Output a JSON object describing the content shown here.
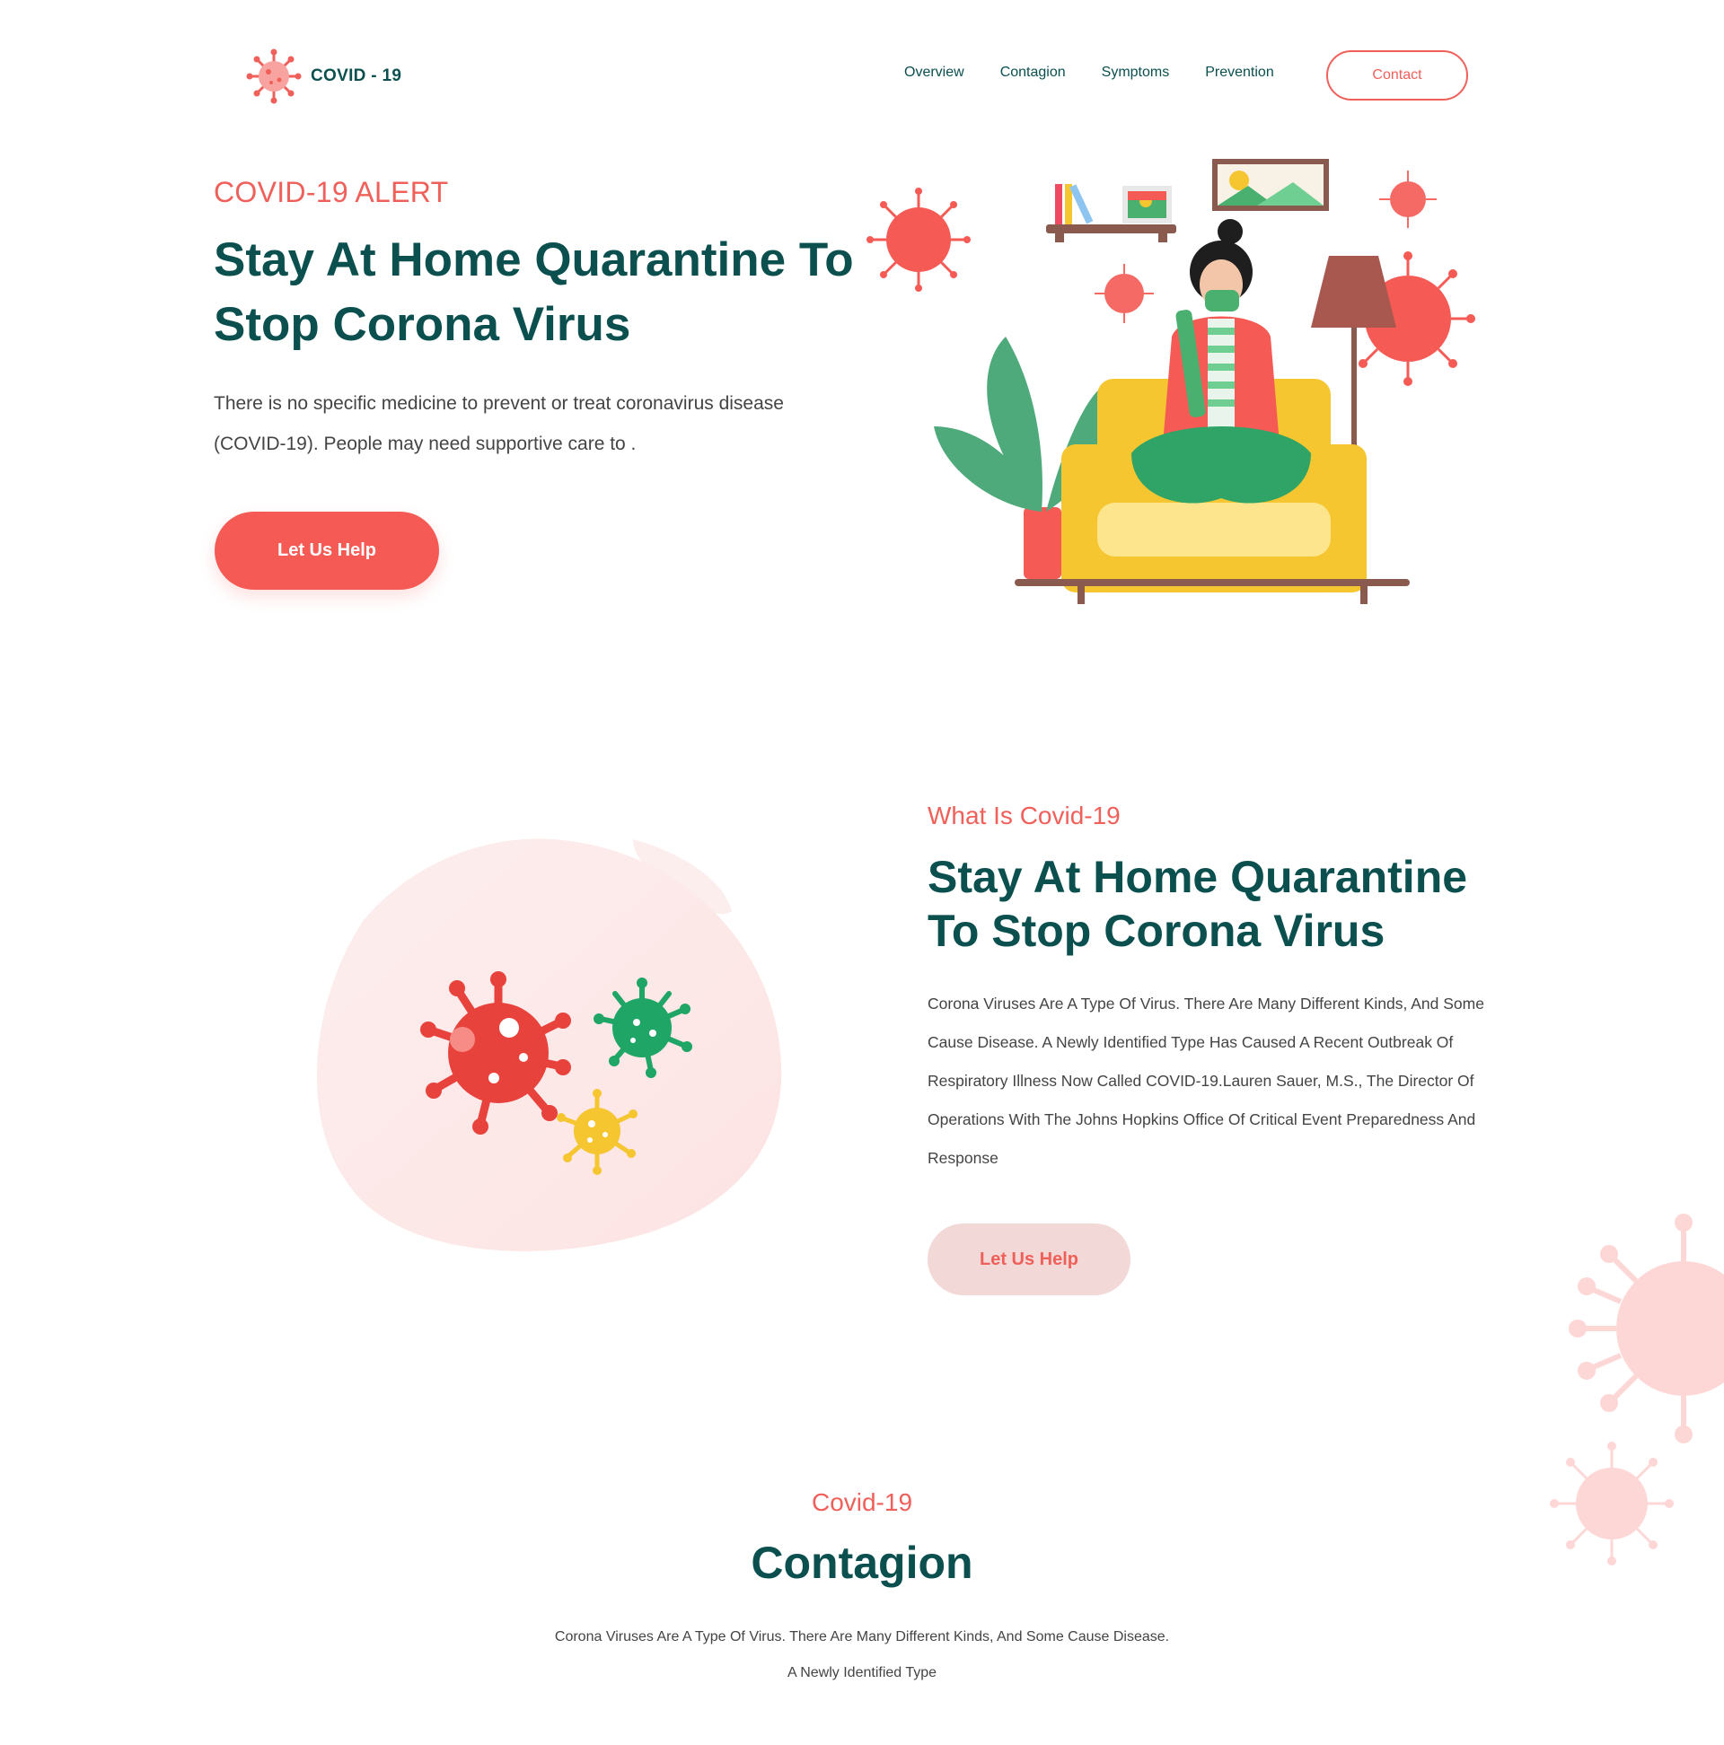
{
  "colors": {
    "brand_red": "#f0605a",
    "heading_teal": "#0b4f4f",
    "body_text": "#444444",
    "soft_pink": "#f2d8d6"
  },
  "nav": {
    "logo_text": "COVID - 19",
    "logo_icon": "virus-icon",
    "items": [
      {
        "label": "Overview"
      },
      {
        "label": "Contagion"
      },
      {
        "label": "Symptoms"
      },
      {
        "label": "Prevention"
      }
    ],
    "contact_label": "Contact"
  },
  "hero": {
    "eyebrow": "COVID-19 ALERT",
    "title": "Stay At Home Quarantine To Stop Corona Virus",
    "text": "There is no specific medicine to prevent or treat coronavirus disease (COVID-19). People may need supportive care to .",
    "button_label": "Let Us Help",
    "illustration": "woman-on-sofa-illustration"
  },
  "about": {
    "eyebrow": "What Is Covid-19",
    "title": "Stay At Home Quarantine To Stop Corona Virus",
    "text": "Corona Viruses Are A Type Of Virus. There Are Many Different Kinds, And Some Cause Disease. A Newly Identified Type Has Caused A Recent Outbreak Of Respiratory Illness Now Called COVID-19.Lauren Sauer, M.S., The Director Of Operations With The Johns Hopkins Office Of Critical Event Preparedness And Response",
    "button_label": "Let Us Help",
    "illustration": "virus-cluster-illustration"
  },
  "contagion": {
    "eyebrow": "Covid-19",
    "title": "Contagion",
    "text_line1": "Corona Viruses Are A Type Of Virus. There Are Many Different Kinds, And Some Cause Disease.",
    "text_line2": "A Newly Identified Type"
  }
}
